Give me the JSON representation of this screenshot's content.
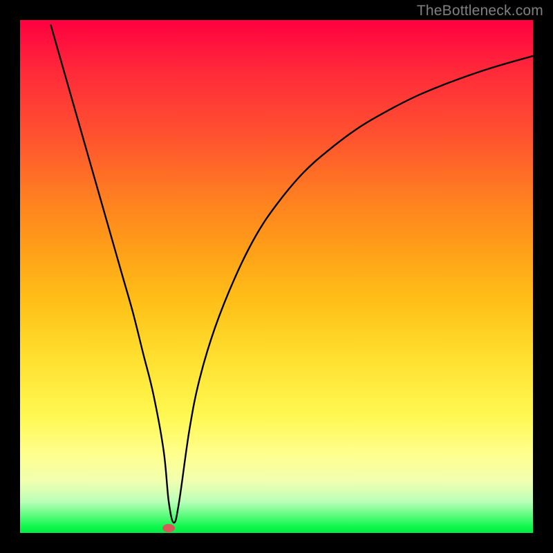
{
  "watermark": "TheBottleneck.com",
  "chart_data": {
    "type": "line",
    "title": "",
    "xlabel": "",
    "ylabel": "",
    "xlim": [
      0,
      100
    ],
    "ylim": [
      0,
      100
    ],
    "background_gradient": [
      "#ff0040",
      "#08e848"
    ],
    "series": [
      {
        "name": "curve",
        "x": [
          6,
          8,
          10,
          12,
          14,
          16,
          18,
          20,
          22,
          24,
          26,
          28,
          29,
          30,
          31,
          33,
          35,
          38,
          42,
          46,
          50,
          55,
          60,
          66,
          72,
          78,
          85,
          92,
          100
        ],
        "y": [
          99,
          92,
          85,
          78,
          71,
          64,
          57,
          50,
          43,
          35,
          27,
          16,
          6,
          2,
          6,
          20,
          30,
          40,
          50,
          58,
          64,
          70,
          74.5,
          79,
          82.5,
          85.5,
          88.3,
          90.7,
          93
        ]
      }
    ],
    "marker": {
      "x": 29,
      "y": 1,
      "color": "#d65a5a"
    }
  }
}
